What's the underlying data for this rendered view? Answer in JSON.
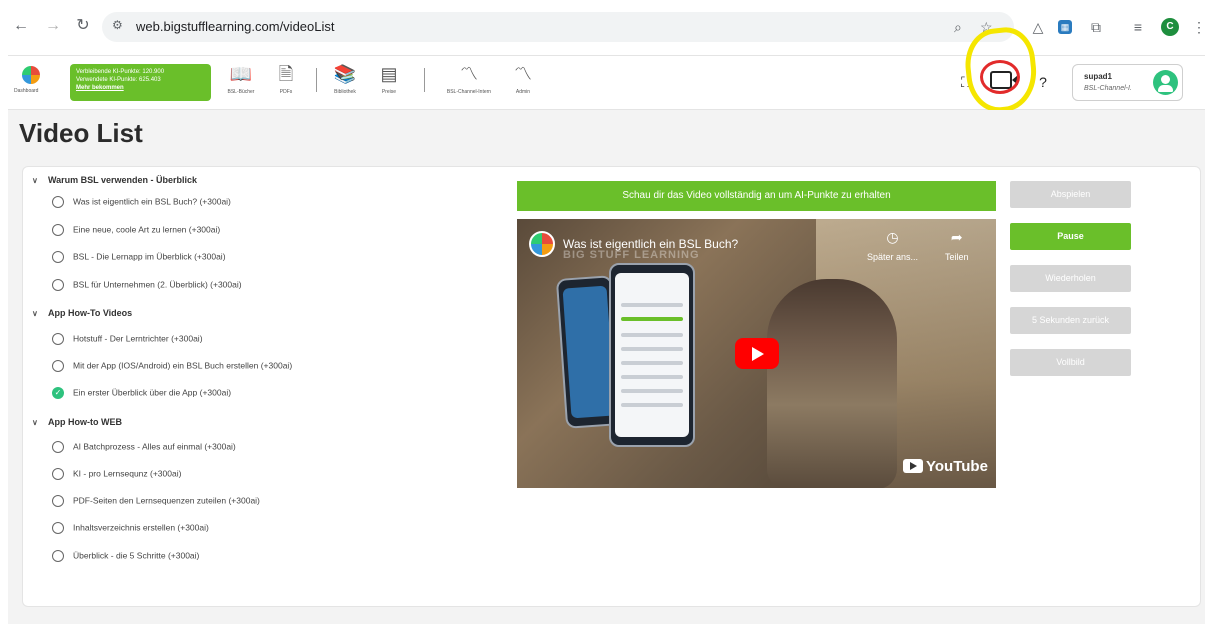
{
  "browser": {
    "url": "web.bigstufflearning.com/videoList",
    "profile_initial": "C"
  },
  "header": {
    "logo_label": "Dashboard",
    "points": {
      "remaining": "Verbleibende KI-Punkte: 120.900",
      "used": "Verwendete KI-Punkte: 625.403",
      "more": "Mehr bekommen"
    },
    "nav": [
      {
        "label": "BSL-Bücher",
        "icon": "book-icon"
      },
      {
        "label": "PDFs",
        "icon": "pdf-icon"
      },
      {
        "label": "Bibliothek",
        "icon": "library-icon"
      },
      {
        "label": "Preise",
        "icon": "pricing-icon"
      },
      {
        "label": "BSL-Channel-Intern",
        "icon": "rss-icon"
      },
      {
        "label": "Admin",
        "icon": "rss-icon"
      }
    ],
    "user": {
      "name": "supad1",
      "channel": "BSL-Channel-I."
    }
  },
  "page": {
    "title": "Video List"
  },
  "sections": [
    {
      "title": "Warum BSL verwenden - Überblick",
      "items": [
        {
          "label": "Was ist eigentlich ein BSL Buch? (+300ai)",
          "done": false
        },
        {
          "label": "Eine neue, coole Art zu lernen (+300ai)",
          "done": false
        },
        {
          "label": "BSL - Die Lernapp im Überblick (+300ai)",
          "done": false
        },
        {
          "label": "BSL für Unternehmen (2. Überblick) (+300ai)",
          "done": false
        }
      ]
    },
    {
      "title": "App How-To Videos",
      "items": [
        {
          "label": "Hotstuff - Der Lerntrichter (+300ai)",
          "done": false
        },
        {
          "label": "Mit der App (IOS/Android) ein BSL Buch erstellen (+300ai)",
          "done": false
        },
        {
          "label": "Ein erster Überblick über die App (+300ai)",
          "done": true
        }
      ]
    },
    {
      "title": "App How-to WEB",
      "items": [
        {
          "label": "AI Batchprozess - Alles auf einmal (+300ai)",
          "done": false
        },
        {
          "label": "KI - pro Lernsequnz (+300ai)",
          "done": false
        },
        {
          "label": "PDF-Seiten den Lernsequenzen zuteilen (+300ai)",
          "done": false
        },
        {
          "label": "Inhaltsverzeichnis erstellen (+300ai)",
          "done": false
        },
        {
          "label": "Überblick - die 5 Schritte (+300ai)",
          "done": false
        }
      ]
    }
  ],
  "video": {
    "banner": "Schau dir das Video vollständig an um AI-Punkte zu erhalten",
    "title": "Was ist eigentlich ein BSL Buch?",
    "watermark": "BIG STUFF LEARNING",
    "watch_later": "Später ans...",
    "share": "Teilen",
    "youtube": "YouTube"
  },
  "controls": {
    "play": "Abspielen",
    "pause": "Pause",
    "repeat": "Wiederholen",
    "back5": "5 Sekunden zurück",
    "fullscreen": "Vollbild"
  },
  "colors": {
    "accent": "#6abf2a",
    "disabled": "#d6d6d6",
    "highlight_yellow": "#f5e600",
    "highlight_red": "#e22b2b"
  }
}
